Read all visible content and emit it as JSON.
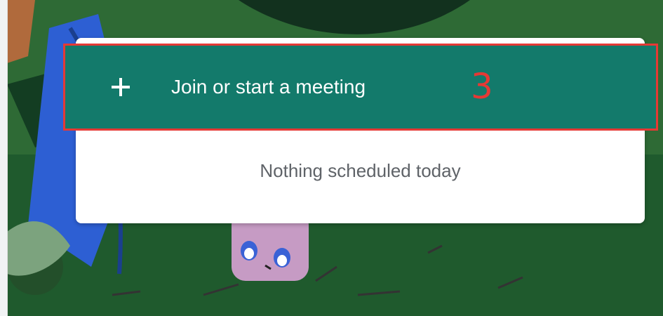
{
  "join_bar": {
    "icon": "plus-icon",
    "label": "Join or start a meeting",
    "color": "#137a6b"
  },
  "annotation": {
    "step_number": "3",
    "color": "#e53935"
  },
  "schedule": {
    "empty_message": "Nothing scheduled today"
  }
}
